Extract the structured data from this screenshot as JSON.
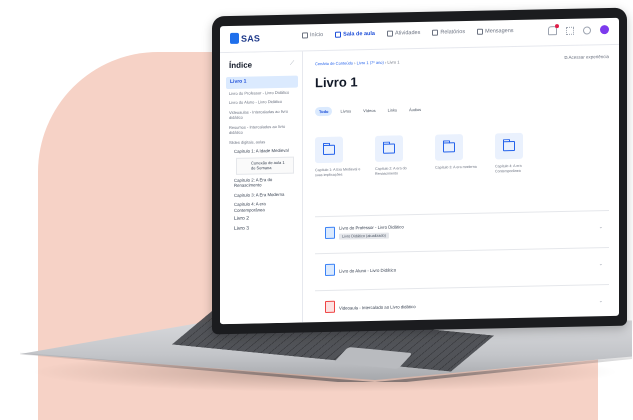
{
  "topbar": {
    "logo": "SAS",
    "nav": [
      {
        "label": "Início",
        "active": false
      },
      {
        "label": "Sala de aula",
        "active": true
      },
      {
        "label": "Atividades",
        "active": false
      },
      {
        "label": "Relatórios",
        "active": false
      },
      {
        "label": "Mensagens",
        "active": false
      }
    ]
  },
  "sidebar": {
    "title": "Índice",
    "items": [
      {
        "label": "Livro 1",
        "type": "active"
      },
      {
        "label": "Livro do Professor - Livro Didático",
        "type": "plain"
      },
      {
        "label": "Livro do Aluno - Livro Didático",
        "type": "plain"
      },
      {
        "label": "Videoaulas - Intercaladas ao livro didático",
        "type": "plain"
      },
      {
        "label": "Resumos - Intercalados ao livro didático",
        "type": "plain"
      },
      {
        "label": "Slides digitais, aulas",
        "type": "plain"
      },
      {
        "label": "Capítulo 1: A Idade Medieval",
        "type": "chapter"
      },
      {
        "label": "Conexão de aula 1 de Semana",
        "type": "sub"
      },
      {
        "label": "Capítulo 2: A Era do Renascimento",
        "type": "chapter"
      },
      {
        "label": "Capítulo 3: A Era Moderna",
        "type": "chapter"
      },
      {
        "label": "Capítulo 4: A era Contemporânea",
        "type": "chapter"
      },
      {
        "label": "Livro 2",
        "type": "book"
      },
      {
        "label": "Livro 3",
        "type": "book"
      }
    ]
  },
  "main": {
    "breadcrumb": [
      "Cenário de Conteúdo",
      "Livro 1 (7º ano)",
      "Livro 1"
    ],
    "access_link": "Acessar experiência",
    "title": "Livro 1",
    "filters": [
      {
        "label": "Todo",
        "active": true
      },
      {
        "label": "Livros",
        "active": false
      },
      {
        "label": "Vídeos",
        "active": false
      },
      {
        "label": "Links",
        "active": false
      },
      {
        "label": "Áudios",
        "active": false
      }
    ],
    "folders": [
      {
        "label": "Capítulo 1: A Era Medieval e suas implicações"
      },
      {
        "label": "Capítulo 2: A era do Renascimento"
      },
      {
        "label": "Capítulo 3: A era moderna"
      },
      {
        "label": "Capítulo 4: A era Contemporânea"
      }
    ],
    "files": [
      {
        "name": "Livro do Professor - Livro Didático",
        "badge": "Livro Didático (atualizado)",
        "icon": "book-icon"
      },
      {
        "name": "Livro do Aluno - Livro Didático",
        "badge": "",
        "icon": "book-icon"
      },
      {
        "name": "Videoaula - Intercalado ao Livro didático",
        "badge": "",
        "icon": "video-icon"
      }
    ]
  }
}
